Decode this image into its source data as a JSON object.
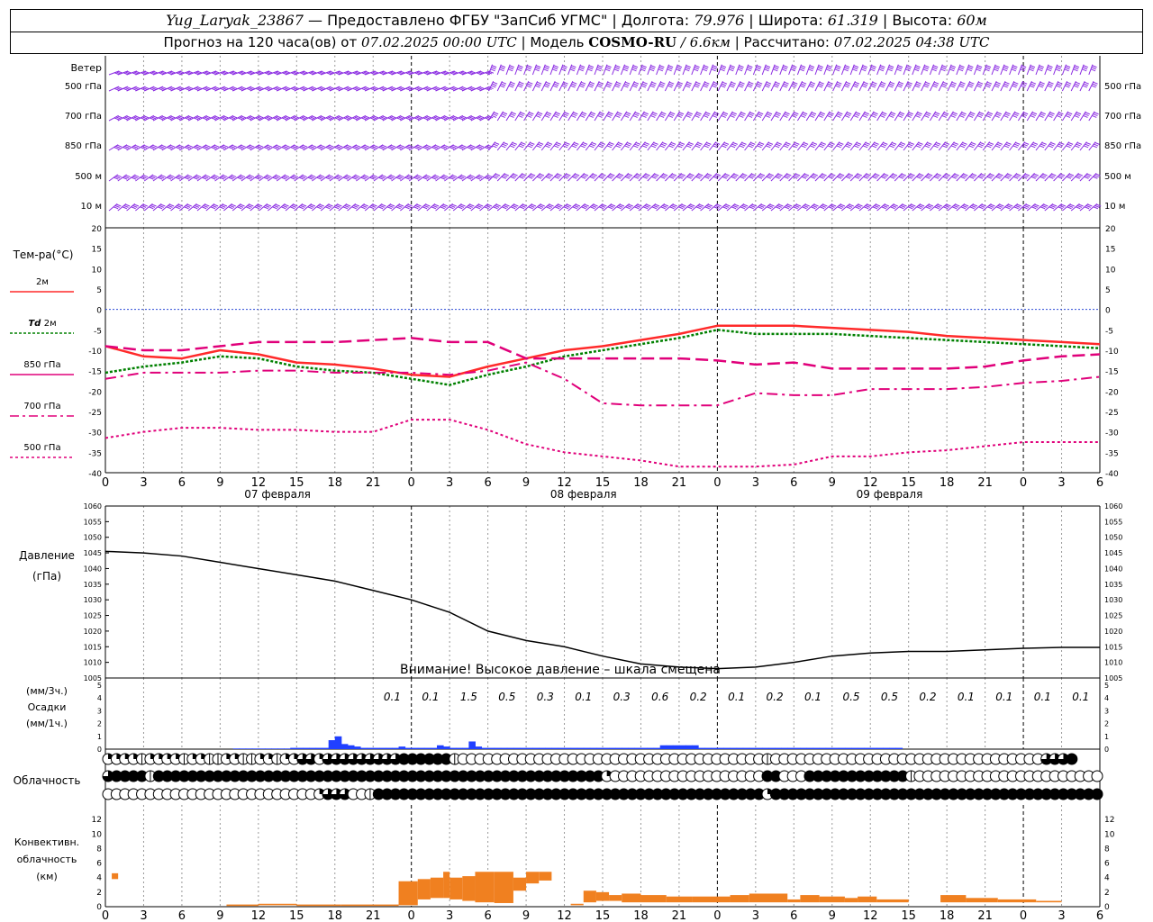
{
  "header": {
    "station": "Yug_Laryak_23867",
    "provider": "— Предоставлено ФГБУ \"ЗапСиб УГМС\"",
    "lon_label": "| Долгота:",
    "lon": "79.976",
    "lat_label": "| Широта:",
    "lat": "61.319",
    "alt_label": "| Высота:",
    "alt": "60м",
    "forecast_label": "Прогноз на 120 часа(ов) от",
    "forecast_time": "07.02.2025 00:00 UTC",
    "model_label": "| Модель",
    "model": "COSMO-RU",
    "model_res": "/ 6.6км",
    "calc_label": "| Рассчитано:",
    "calc_time": "07.02.2025 04:38 UTC"
  },
  "chart_data": [
    {
      "name": "wind",
      "type": "other",
      "title": "Ветер",
      "levels": [
        "500 гПа",
        "700 гПа",
        "850 гПа",
        "500 м",
        "10 м"
      ],
      "barb_color": "#8a2be2"
    },
    {
      "name": "temperature",
      "type": "line",
      "title": "Тем-ра(°С)",
      "ylim": [
        -40,
        20
      ],
      "yticks": [
        20,
        15,
        10,
        5,
        0,
        -5,
        -10,
        -15,
        -20,
        -25,
        -30,
        -35,
        -40
      ],
      "x_hours": [
        0,
        3,
        6,
        9,
        12,
        15,
        18,
        21,
        24,
        27,
        30,
        33,
        36,
        39,
        42,
        45,
        48,
        51,
        54,
        57,
        60,
        63,
        66,
        69,
        72,
        75,
        78
      ],
      "series": [
        {
          "name": "2м",
          "color": "#ff2a2a",
          "values": [
            -9,
            -11.5,
            -12,
            -10,
            -11,
            -13,
            -13.5,
            -14.5,
            -16,
            -16.5,
            -14,
            -12,
            -10,
            -9,
            -7.5,
            -6,
            -4,
            -4,
            -4,
            -4.5,
            -5,
            -5.5,
            -6.5,
            -7,
            -7.5,
            -8,
            -8.5
          ]
        },
        {
          "name": "Td 2м",
          "color": "#008000",
          "values": [
            -15.5,
            -14,
            -13,
            -11.5,
            -12,
            -14,
            -15,
            -15.5,
            -17,
            -18.5,
            -16,
            -14,
            -11.5,
            -10,
            -8.5,
            -7,
            -5,
            -6,
            -6,
            -6,
            -6.5,
            -7,
            -7.5,
            -8,
            -8.5,
            -9,
            -9.5
          ]
        },
        {
          "name": "850 гПа",
          "color": "#e0007a",
          "values": [
            -9,
            -10,
            -10,
            -9,
            -8,
            -8,
            -8,
            -7.5,
            -7,
            -8,
            -8,
            -12,
            -12,
            -12,
            -12,
            -12,
            -12.5,
            -13.5,
            -13,
            -14.5,
            -14.5,
            -14.5,
            -14.5,
            -14,
            -12.5,
            -11.5,
            -11
          ]
        },
        {
          "name": "700 гПа",
          "color": "#e0007a",
          "values": [
            -17,
            -15.5,
            -15.5,
            -15.5,
            -15,
            -15,
            -15.5,
            -15.5,
            -15.5,
            -16,
            -15,
            -13,
            -17,
            -23,
            -23.5,
            -23.5,
            -23.5,
            -20.5,
            -21,
            -21,
            -19.5,
            -19.5,
            -19.5,
            -19,
            -18,
            -17.5,
            -16.5
          ]
        },
        {
          "name": "500 гПа",
          "color": "#e0007a",
          "values": [
            -31.5,
            -30,
            -29,
            -29,
            -29.5,
            -29.5,
            -30,
            -30,
            -27,
            -27,
            -29.5,
            -33,
            -35,
            -36,
            -37,
            -38.5,
            -38.5,
            -38.5,
            -38,
            -36,
            -36,
            -35,
            -34.5,
            -33.5,
            -32.5,
            -32.5,
            -32.5
          ]
        }
      ],
      "zero_line_color": "#2d4bd8"
    },
    {
      "name": "pressure",
      "type": "line",
      "title": "Давление",
      "ylabel": "(гПа)",
      "ylim": [
        1005,
        1060
      ],
      "yticks": [
        1060,
        1055,
        1050,
        1045,
        1040,
        1035,
        1030,
        1025,
        1020,
        1015,
        1010,
        1005
      ],
      "x_hours": [
        0,
        3,
        6,
        9,
        12,
        15,
        18,
        21,
        24,
        27,
        30,
        33,
        36,
        39,
        42,
        45,
        48,
        51,
        54,
        57,
        60,
        63,
        66,
        69,
        72,
        75,
        78
      ],
      "values": [
        1045.5,
        1045,
        1044,
        1042,
        1040,
        1038,
        1036,
        1033,
        1030,
        1026,
        1020,
        1017,
        1015,
        1012,
        1009.5,
        1008.5,
        1008,
        1008.5,
        1010,
        1012,
        1013,
        1013.5,
        1013.5,
        1014,
        1014.5,
        1014.8,
        1014.8
      ],
      "annotation": "Внимание! Высокое давление – шкала смещена"
    },
    {
      "name": "precipitation",
      "type": "bar",
      "title": "Осадки",
      "ylabel_3h": "(мм/3ч.)",
      "ylabel_1h": "(мм/1ч.)",
      "ylim": [
        0,
        5
      ],
      "yticks": [
        5,
        4,
        3,
        2,
        1,
        0
      ],
      "color": "#2040ff",
      "labels_3h": [
        "0.1",
        "0.1",
        "1.5",
        "0.5",
        "0.3",
        "0.1",
        "0.3",
        "0.6",
        "0.2",
        "0.1",
        "0.2",
        "0.1",
        "0.5",
        "0.5",
        "0.2",
        "0.1",
        "0.1",
        "0.1",
        "0.1"
      ],
      "hourly": [
        0,
        0,
        0,
        0,
        0,
        0,
        0,
        0,
        0,
        0,
        0,
        0,
        0,
        0,
        0,
        0,
        0,
        0,
        0,
        0,
        0.05,
        0.05,
        0.05,
        0.05,
        0.05,
        0.05,
        0.05,
        0.05,
        0.05,
        0.1,
        0.1,
        0.1,
        0.1,
        0.1,
        0.1,
        0.7,
        1.0,
        0.4,
        0.3,
        0.2,
        0.1,
        0.1,
        0.1,
        0.1,
        0.1,
        0.1,
        0.2,
        0.1,
        0.1,
        0.1,
        0.1,
        0.1,
        0.3,
        0.2,
        0.1,
        0.1,
        0.1,
        0.6,
        0.2,
        0.1,
        0.1,
        0.1,
        0.1,
        0.1,
        0.1,
        0.1,
        0.1,
        0.1,
        0.1,
        0.1,
        0.1,
        0.1,
        0.1,
        0.1,
        0.1,
        0.1,
        0.1,
        0.1,
        0.1,
        0.1,
        0.1,
        0.1,
        0.1,
        0.1,
        0.1,
        0.1,
        0.1,
        0.3,
        0.3,
        0.3,
        0.3,
        0.3,
        0.3,
        0.1,
        0.1,
        0.1,
        0.1,
        0.1,
        0.1,
        0.1,
        0.1,
        0.1,
        0.1,
        0.1,
        0.1,
        0.1,
        0.1,
        0.1,
        0.1,
        0.1,
        0.1,
        0.1,
        0.1,
        0.1,
        0.1,
        0.1,
        0.1,
        0.1,
        0.1,
        0.1,
        0.1,
        0.1,
        0.1,
        0.1,
        0.1,
        0
      ]
    },
    {
      "name": "cloudiness",
      "type": "other",
      "title": "Облачность",
      "rows": [
        "2222122221221122112212233233333333344444410000000000000000000000000000000000001000000000000000000000000000000003334",
        "3444414444444444444444444444444444444444444444444444444444420000000000000000004400044444444444410000000000000000000000000003",
        "0000000000000000000000000233300144444444444444444444444444444444444444444444442444444444444444444444444444444444444444444444"
      ]
    },
    {
      "name": "convective_cloud",
      "type": "bar",
      "title": "Конвективн.",
      "subtitle": "облачность",
      "ylabel": "(км)",
      "ylim": [
        0,
        14
      ],
      "yticks": [
        12,
        10,
        8,
        6,
        4,
        2,
        0
      ],
      "color": "#f08020",
      "bars": [
        [
          1,
          2,
          3.8,
          4.6
        ],
        [
          19,
          24,
          0.1,
          0.3
        ],
        [
          24,
          30,
          0.2,
          0.4
        ],
        [
          30,
          37,
          0.1,
          0.3
        ],
        [
          37,
          46,
          0.1,
          0.3
        ],
        [
          46,
          49,
          0.2,
          3.5
        ],
        [
          49,
          51,
          1.0,
          3.8
        ],
        [
          51,
          53,
          1.2,
          4.0
        ],
        [
          53,
          54,
          1.2,
          4.8
        ],
        [
          54,
          56,
          1.0,
          4.0
        ],
        [
          56,
          58,
          0.8,
          4.2
        ],
        [
          58,
          61,
          0.6,
          4.8
        ],
        [
          61,
          64,
          0.5,
          4.8
        ],
        [
          64,
          66,
          2.2,
          4.0
        ],
        [
          66,
          68,
          3.2,
          4.8
        ],
        [
          68,
          70,
          3.6,
          4.8
        ],
        [
          73,
          75,
          0.2,
          0.4
        ],
        [
          75,
          77,
          0.6,
          2.2
        ],
        [
          77,
          79,
          0.8,
          2.0
        ],
        [
          79,
          81,
          0.8,
          1.6
        ],
        [
          81,
          84,
          0.6,
          1.8
        ],
        [
          84,
          88,
          0.6,
          1.6
        ],
        [
          88,
          92,
          0.6,
          1.4
        ],
        [
          92,
          98,
          0.6,
          1.4
        ],
        [
          98,
          101,
          0.6,
          1.6
        ],
        [
          101,
          104,
          0.6,
          1.8
        ],
        [
          104,
          107,
          0.6,
          1.8
        ],
        [
          107,
          109,
          0.6,
          1.0
        ],
        [
          109,
          112,
          0.6,
          1.6
        ],
        [
          112,
          116,
          0.6,
          1.4
        ],
        [
          116,
          118,
          0.6,
          1.2
        ],
        [
          118,
          121,
          0.6,
          1.4
        ],
        [
          121,
          126,
          0.6,
          1.0
        ],
        [
          131,
          135,
          0.6,
          1.6
        ],
        [
          135,
          140,
          0.6,
          1.2
        ],
        [
          140,
          146,
          0.6,
          1.0
        ],
        [
          146,
          150,
          0.6,
          0.8
        ]
      ]
    }
  ],
  "time_axis": {
    "ticks": [
      "0",
      "3",
      "6",
      "9",
      "12",
      "15",
      "18",
      "21",
      "0",
      "3",
      "6",
      "9",
      "12",
      "15",
      "18",
      "21",
      "0",
      "3",
      "6",
      "9",
      "12",
      "15",
      "18",
      "21",
      "0",
      "3",
      "6"
    ],
    "days": [
      "07 февраля",
      "08 февраля",
      "09 февраля"
    ]
  },
  "legend": {
    "t2m": "2м",
    "td_prefix": "Td",
    "td": "2м",
    "t850": "850 гПа",
    "t700": "700 гПа",
    "t500": "500 гПа"
  }
}
